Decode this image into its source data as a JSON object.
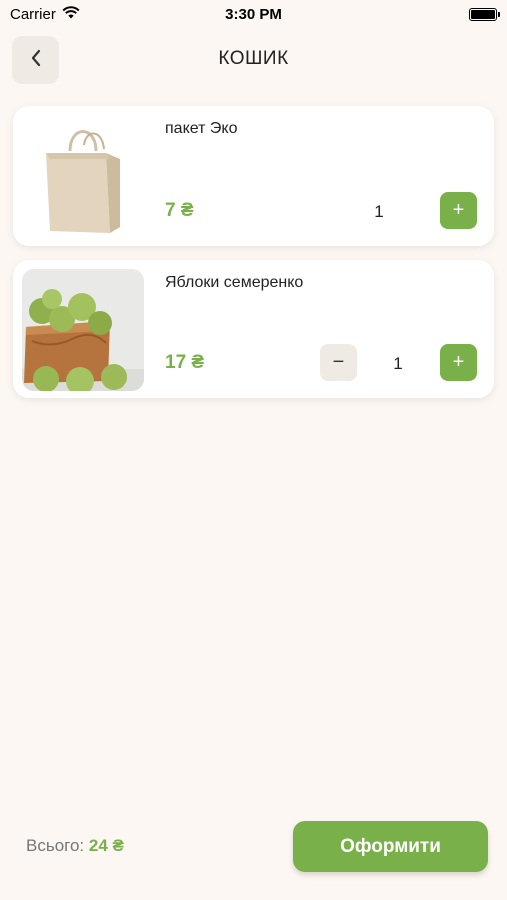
{
  "status_bar": {
    "carrier": "Carrier",
    "time": "3:30 PM"
  },
  "header": {
    "title": "КОШИК"
  },
  "cart": {
    "items": [
      {
        "name": "пакет Эко",
        "price": "7 ₴",
        "quantity": "1",
        "plus": "+",
        "minus": "−"
      },
      {
        "name": "Яблоки семеренко",
        "price": "17 ₴",
        "quantity": "1",
        "plus": "+",
        "minus": "−"
      }
    ]
  },
  "footer": {
    "total_label": "Всього: ",
    "total_value": "24 ₴",
    "checkout_label": "Оформити"
  },
  "colors": {
    "accent": "#7ab04a",
    "background": "#fcf7f2",
    "button_secondary": "#efeae4"
  }
}
